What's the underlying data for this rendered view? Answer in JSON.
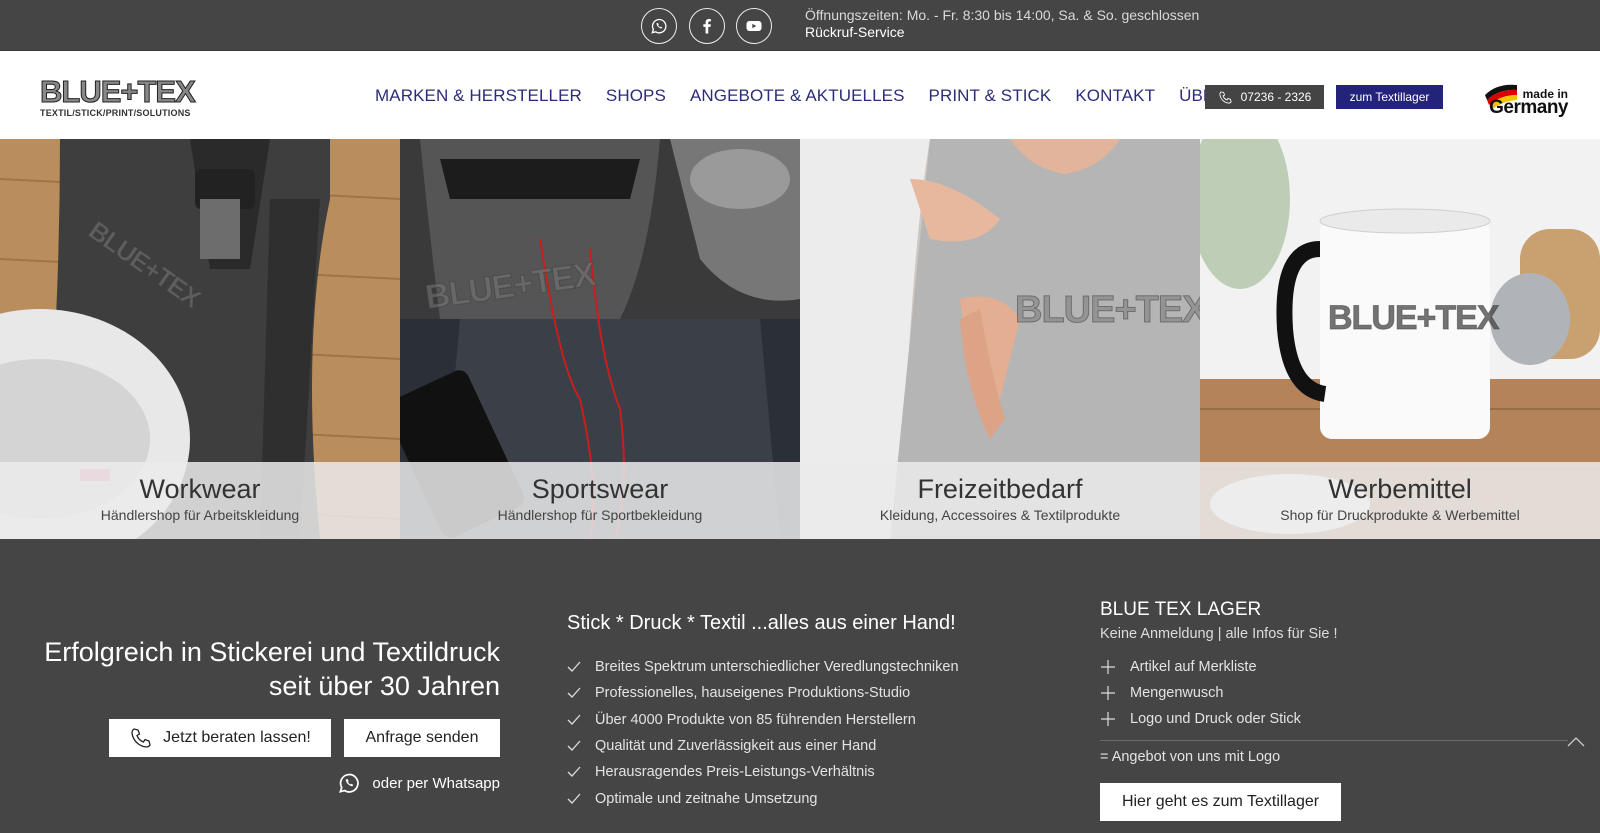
{
  "topbar": {
    "social": [
      {
        "name": "whatsapp-icon"
      },
      {
        "name": "facebook-icon"
      },
      {
        "name": "youtube-icon"
      }
    ],
    "hours": "Öffnungszeiten: Mo. - Fr. 8:30 bis 14:00, Sa. & So. geschlossen",
    "callback": "Rückruf-Service"
  },
  "header": {
    "logo_word": "BLUE+TEX",
    "logo_tag": "TEXTIL/STICK/PRINT/SOLUTIONS",
    "nav": [
      "MARKEN & HERSTELLER",
      "SHOPS",
      "ANGEBOTE & AKTUELLES",
      "PRINT & STICK",
      "KONTAKT",
      "ÜBER UNS"
    ],
    "phone": "07236 - 2326",
    "lager_button": "zum Textillager",
    "made_in": "made in",
    "germany": "Germany"
  },
  "tiles": [
    {
      "title": "Workwear",
      "subtitle": "Händlershop für Arbeitskleidung"
    },
    {
      "title": "Sportswear",
      "subtitle": "Händlershop für Sportbekleidung"
    },
    {
      "title": "Freizeitbedarf",
      "subtitle": "Kleidung, Accessoires & Textilprodukte"
    },
    {
      "title": "Werbemittel",
      "subtitle": "Shop für Druckprodukte & Werbemittel"
    }
  ],
  "bottom": {
    "tagline_1": "Erfolgreich in Stickerei und Textildruck",
    "tagline_2": "seit über 30 Jahren",
    "advice_button": "Jetzt beraten lassen!",
    "request_button": "Anfrage senden",
    "whatsapp_text": "oder per Whatsapp",
    "mid_title": "Stick * Druck * Textil ...alles aus einer Hand!",
    "checks": [
      "Breites Spektrum unterschiedlicher Veredlungstechniken",
      "Professionelles, hauseigenes Produktions-Studio",
      "Über 4000 Produkte von 85 führenden Herstellern",
      "Qualität und Zuverlässigkeit aus einer Hand",
      "Herausragendes Preis-Leistungs-Verhältnis",
      "Optimale und zeitnahe Umsetzung"
    ],
    "right_title": "BLUE TEX LAGER",
    "right_sub": "Keine Anmeldung | alle Infos für Sie !",
    "plus_items": [
      "Artikel auf Merkliste",
      "Mengenwusch",
      "Logo und Druck oder Stick"
    ],
    "offer_line": "= Angebot von uns mit Logo",
    "lager_cta": "Hier geht es zum Textillager"
  },
  "colors": {
    "dark": "#454545",
    "nav_blue": "#2c2c7a",
    "button_blue": "#23237a"
  }
}
